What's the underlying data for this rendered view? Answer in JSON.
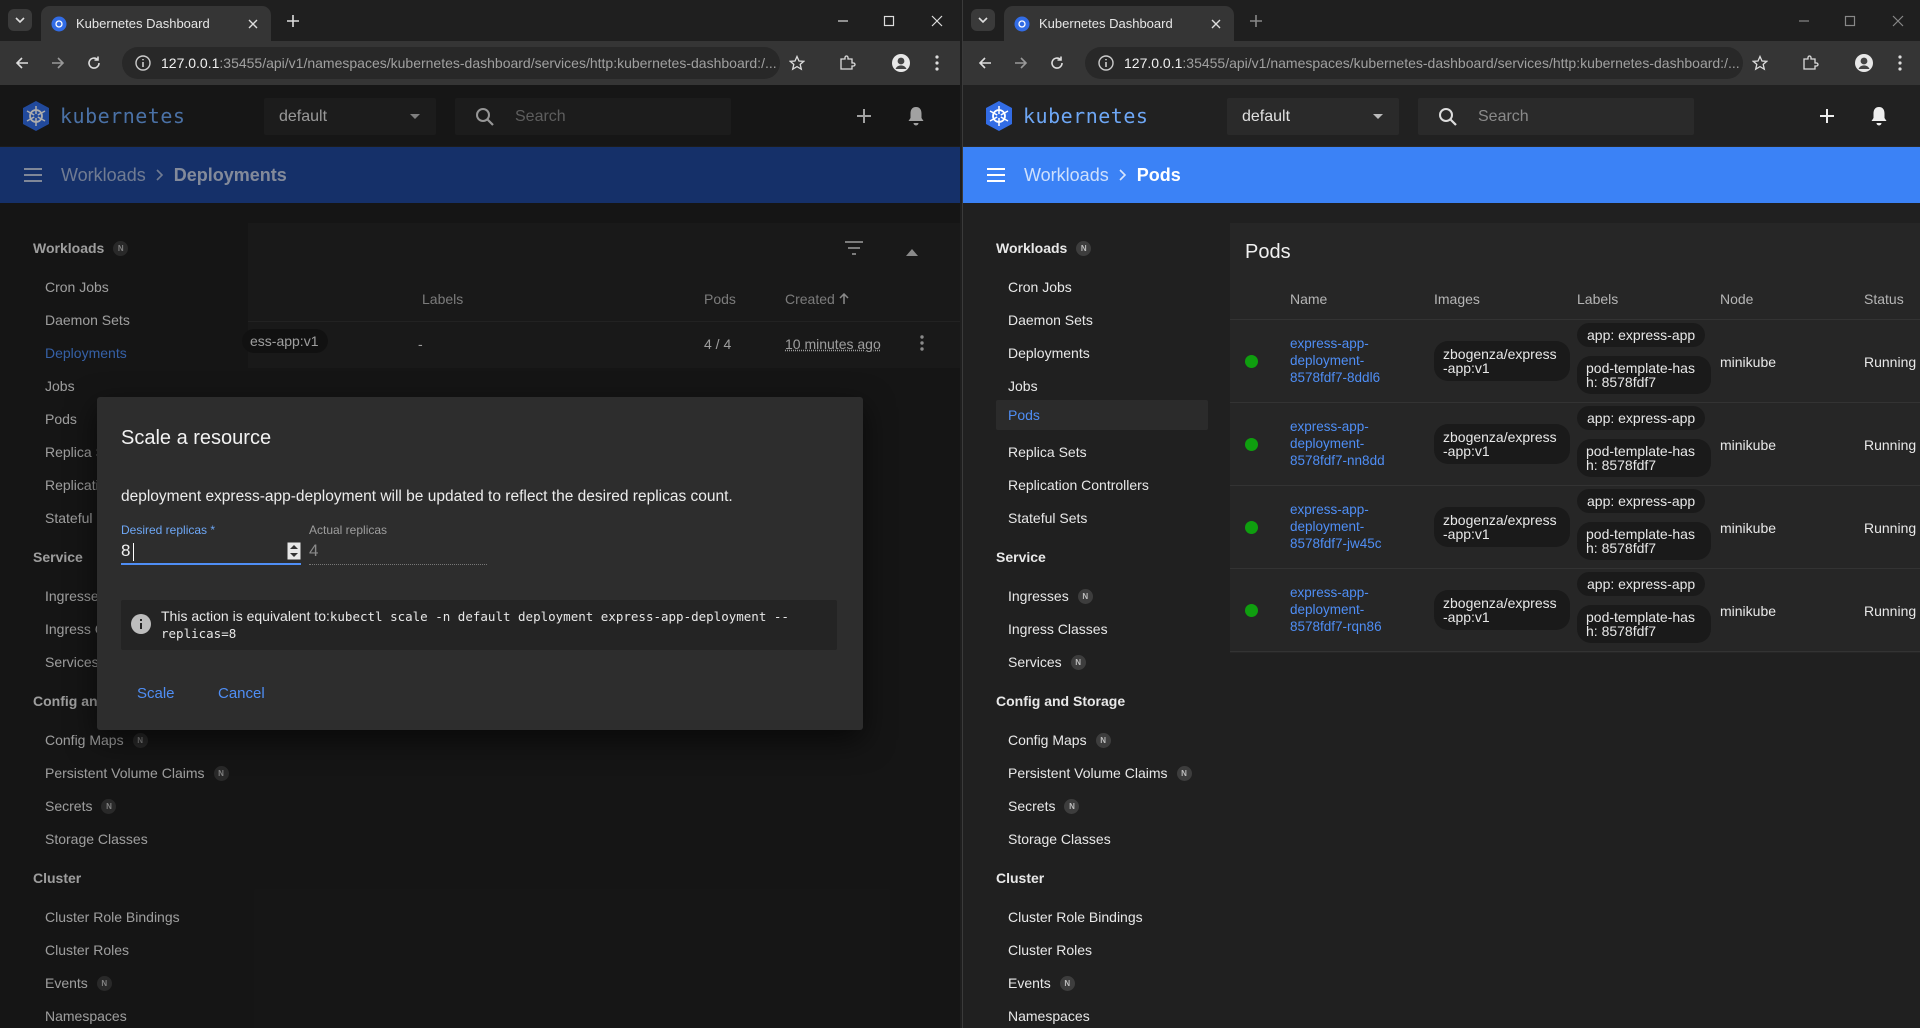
{
  "windows": {
    "left": {
      "tab_title": "Kubernetes Dashboard",
      "url_host": "127.0.0.1",
      "url_path": ":35455/api/v1/namespaces/kubernetes-dashboard/services/http:kubernetes-dashboard:/...",
      "brand": "kubernetes",
      "namespace": "default",
      "search_placeholder": "Search",
      "breadcrumb": {
        "parent": "Workloads",
        "current": "Deployments"
      },
      "table": {
        "headers": {
          "labels": "Labels",
          "pods": "Pods",
          "created": "Created"
        },
        "row": {
          "image_fragment": "ess-app:v1",
          "labels": "-",
          "pods": "4 / 4",
          "created": "10 minutes ago"
        }
      },
      "dialog": {
        "title": "Scale a resource",
        "message": "deployment express-app-deployment will be updated to reflect the desired replicas count.",
        "desired_label": "Desired replicas *",
        "desired_value": "8",
        "actual_label": "Actual replicas",
        "actual_value": "4",
        "info_prefix": "This action is equivalent to:",
        "info_command_1": "kubectl scale -n default deployment express-app-deployment --",
        "info_command_2": "replicas=8",
        "scale_btn": "Scale",
        "cancel_btn": "Cancel"
      }
    },
    "right": {
      "tab_title": "Kubernetes Dashboard",
      "url_host": "127.0.0.1",
      "url_path": ":35455/api/v1/namespaces/kubernetes-dashboard/services/http:kubernetes-dashboard:/...",
      "brand": "kubernetes",
      "namespace": "default",
      "search_placeholder": "Search",
      "breadcrumb": {
        "parent": "Workloads",
        "current": "Pods"
      },
      "card_title": "Pods",
      "headers": {
        "name": "Name",
        "images": "Images",
        "labels": "Labels",
        "node": "Node",
        "status": "Status"
      },
      "pods": [
        {
          "name_1": "express-app-",
          "name_2": "deployment-",
          "name_3": "8578fdf7-8ddl6",
          "image_1": "zbogenza/express",
          "image_2": "-app:v1",
          "label_app": "app: express-app",
          "label_hash_1": "pod-template-has",
          "label_hash_2": "h: 8578fdf7",
          "node": "minikube",
          "status": "Running"
        },
        {
          "name_1": "express-app-",
          "name_2": "deployment-",
          "name_3": "8578fdf7-nn8dd",
          "image_1": "zbogenza/express",
          "image_2": "-app:v1",
          "label_app": "app: express-app",
          "label_hash_1": "pod-template-has",
          "label_hash_2": "h: 8578fdf7",
          "node": "minikube",
          "status": "Running"
        },
        {
          "name_1": "express-app-",
          "name_2": "deployment-",
          "name_3": "8578fdf7-jw45c",
          "image_1": "zbogenza/express",
          "image_2": "-app:v1",
          "label_app": "app: express-app",
          "label_hash_1": "pod-template-has",
          "label_hash_2": "h: 8578fdf7",
          "node": "minikube",
          "status": "Running"
        },
        {
          "name_1": "express-app-",
          "name_2": "deployment-",
          "name_3": "8578fdf7-rqn86",
          "image_1": "zbogenza/express",
          "image_2": "-app:v1",
          "label_app": "app: express-app",
          "label_hash_1": "pod-template-has",
          "label_hash_2": "h: 8578fdf7",
          "node": "minikube",
          "status": "Running"
        }
      ]
    }
  },
  "sidebar": {
    "workloads": "Workloads",
    "badge": "N",
    "cron_jobs": "Cron Jobs",
    "daemon_sets": "Daemon Sets",
    "deployments": "Deployments",
    "jobs": "Jobs",
    "pods": "Pods",
    "replica_sets": "Replica Sets",
    "replication_controllers": "Replication Controllers",
    "stateful_sets": "Stateful Sets",
    "service": "Service",
    "ingresses": "Ingresses",
    "ingress_classes": "Ingress Classes",
    "services": "Services",
    "config_storage": "Config and Storage",
    "config_maps": "Config Maps",
    "pvc": "Persistent Volume Claims",
    "secrets": "Secrets",
    "storage_classes": "Storage Classes",
    "cluster": "Cluster",
    "cluster_role_bindings": "Cluster Role Bindings",
    "cluster_roles": "Cluster Roles",
    "events": "Events",
    "namespaces": "Namespaces"
  },
  "left_sidebar_truncated": {
    "replica_sets": "Replica S",
    "replication": "Replicati",
    "stateful": "Stateful",
    "ingresses": "Ingresse",
    "ingress": "Ingress C",
    "services": "Services",
    "config": "Config and"
  },
  "colors": {
    "accent_blue": "#326ce5",
    "breadcrumb_bar_active": "#3b82f6",
    "breadcrumb_bar_dimmed": "#20489b",
    "link": "#4f8ef5",
    "running_dot": "#0f9e0f"
  }
}
